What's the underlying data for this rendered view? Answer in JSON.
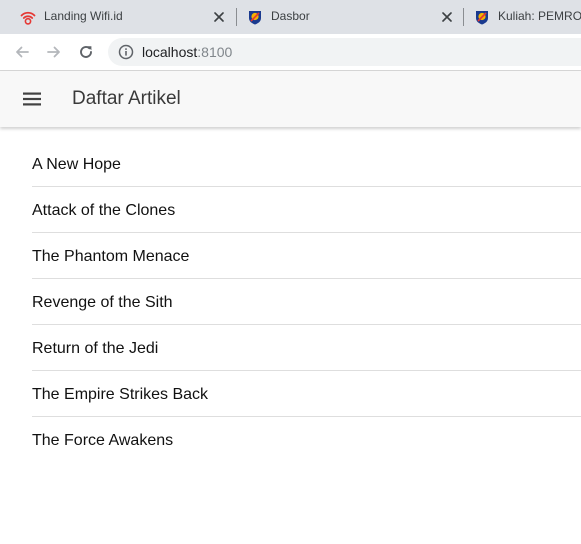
{
  "browser": {
    "tabs": [
      {
        "title": "Landing Wifi.id",
        "icon": "wifi-icon"
      },
      {
        "title": "Dasbor",
        "icon": "moodle-icon"
      },
      {
        "title": "Kuliah: PEMROG",
        "icon": "moodle-icon"
      }
    ],
    "address": {
      "host": "localhost",
      "port": ":8100"
    },
    "colors": {
      "tabstrip": "#dee1e6",
      "omnibox": "#f1f3f4",
      "wifi_icon": "#e53935"
    }
  },
  "app": {
    "title": "Daftar Artikel",
    "header_bg": "#f8f8f8",
    "menu_icon": "hamburger-menu-icon"
  },
  "articles": [
    "A New Hope",
    "Attack of the Clones",
    "The Phantom Menace",
    "Revenge of the Sith",
    "Return of the Jedi",
    "The Empire Strikes Back",
    "The Force Awakens"
  ]
}
